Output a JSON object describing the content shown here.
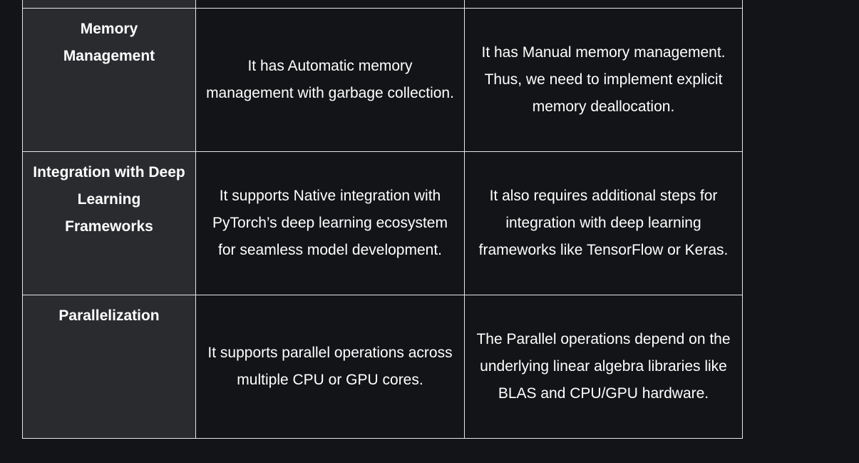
{
  "comparison_table": {
    "rows": [
      {
        "feature": "",
        "col_a": "",
        "col_b": ""
      },
      {
        "feature": "Memory Management",
        "col_a": "It has Automatic memory management with garbage collection.",
        "col_b": "It has Manual memory management. Thus, we need to implement explicit memory deallocation."
      },
      {
        "feature": "Integration with Deep Learning Frameworks",
        "col_a": "It supports Native integration with PyTorch’s deep learning ecosystem for seamless model development.",
        "col_b": "It also requires additional steps for integration with deep learning frameworks like TensorFlow or Keras."
      },
      {
        "feature": "Parallelization",
        "col_a": "It supports parallel operations across multiple CPU or GPU cores.",
        "col_b": "The Parallel operations depend on the underlying linear algebra libraries like BLAS and CPU/GPU hardware."
      }
    ]
  },
  "colors": {
    "page_background": "#131417",
    "feature_cell_background": "#2a2b2f",
    "border": "#e6e6e6",
    "text": "#ffffff"
  }
}
